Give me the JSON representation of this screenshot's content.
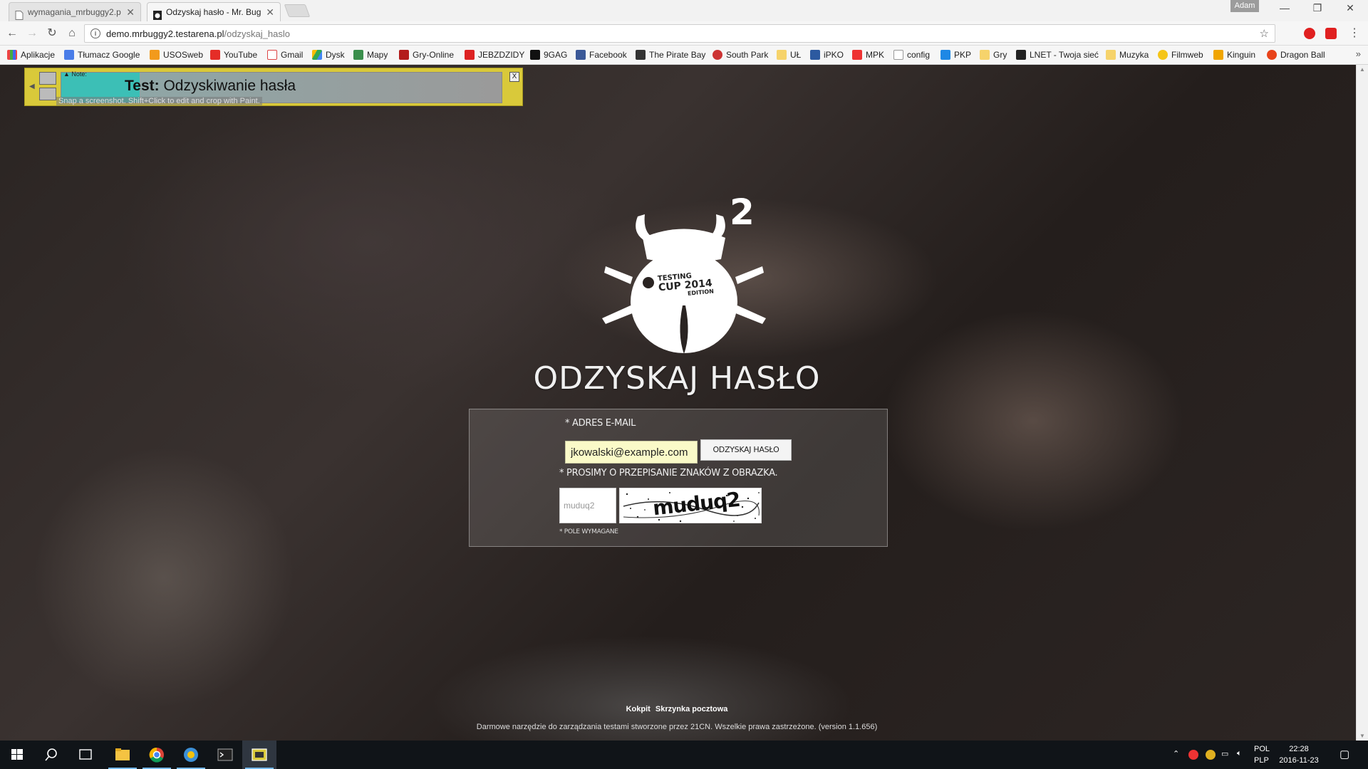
{
  "browser": {
    "tabs": [
      {
        "title": "wymagania_mrbuggy2.p",
        "active": false
      },
      {
        "title": "Odzyskaj hasło - Mr. Bug",
        "active": true
      }
    ],
    "user": "Adam",
    "url_host": "demo.mrbuggy2.testarena.pl",
    "url_path": "/odzyskaj_haslo",
    "bookmarks": [
      "Aplikacje",
      "Tłumacz Google",
      "USOSweb",
      "YouTube",
      "Gmail",
      "Dysk",
      "Mapy",
      "Gry-Online",
      "JEBZDZIDY",
      "9GAG",
      "Facebook",
      "The Pirate Bay",
      "South Park",
      "UŁ",
      "iPKO",
      "MPK",
      "config",
      "PKP",
      "Gry",
      "LNET - Twoja sieć",
      "Muzyka",
      "Filmweb",
      "Kinguin",
      "Dragon Ball"
    ]
  },
  "note": {
    "label": "▲ Note:",
    "text_bold": "Test:",
    "text": "Odzyskiwanie hasła",
    "hint": "Snap a screenshot. Shift+Click to edit and crop with Paint.",
    "close": "X"
  },
  "page": {
    "logo_superscript": "2",
    "logo_badge_line1": "TESTING",
    "logo_badge_line2": "CUP 2014",
    "logo_badge_line3": "EDITION",
    "title": "ODZYSKAJ HASŁO",
    "form": {
      "email_label": "* ADRES E-MAIL",
      "email_value": "jkowalski@example.com",
      "submit_label": "ODZYSKAJ HASŁO",
      "captcha_label": "* PROSIMY O PRZEPISANIE ZNAKÓW Z OBRAZKA.",
      "captcha_value": "muduq2",
      "captcha_image_text": "muduq2",
      "required_note": "* POLE WYMAGANE"
    },
    "footer": {
      "link1": "Kokpit",
      "link2": "Skrzynka pocztowa",
      "copyright": "Darmowe narzędzie do zarządzania testami stworzone przez 21CN. Wszelkie prawa zastrzeżone. (version 1.1.656)"
    }
  },
  "taskbar": {
    "lang1": "POL",
    "lang2": "PLP",
    "time": "22:28",
    "date": "2016-11-23"
  },
  "colors": {
    "note_bg": "#d9c93a",
    "email_bg": "#fafac8",
    "taskbar_bg": "#101418"
  }
}
